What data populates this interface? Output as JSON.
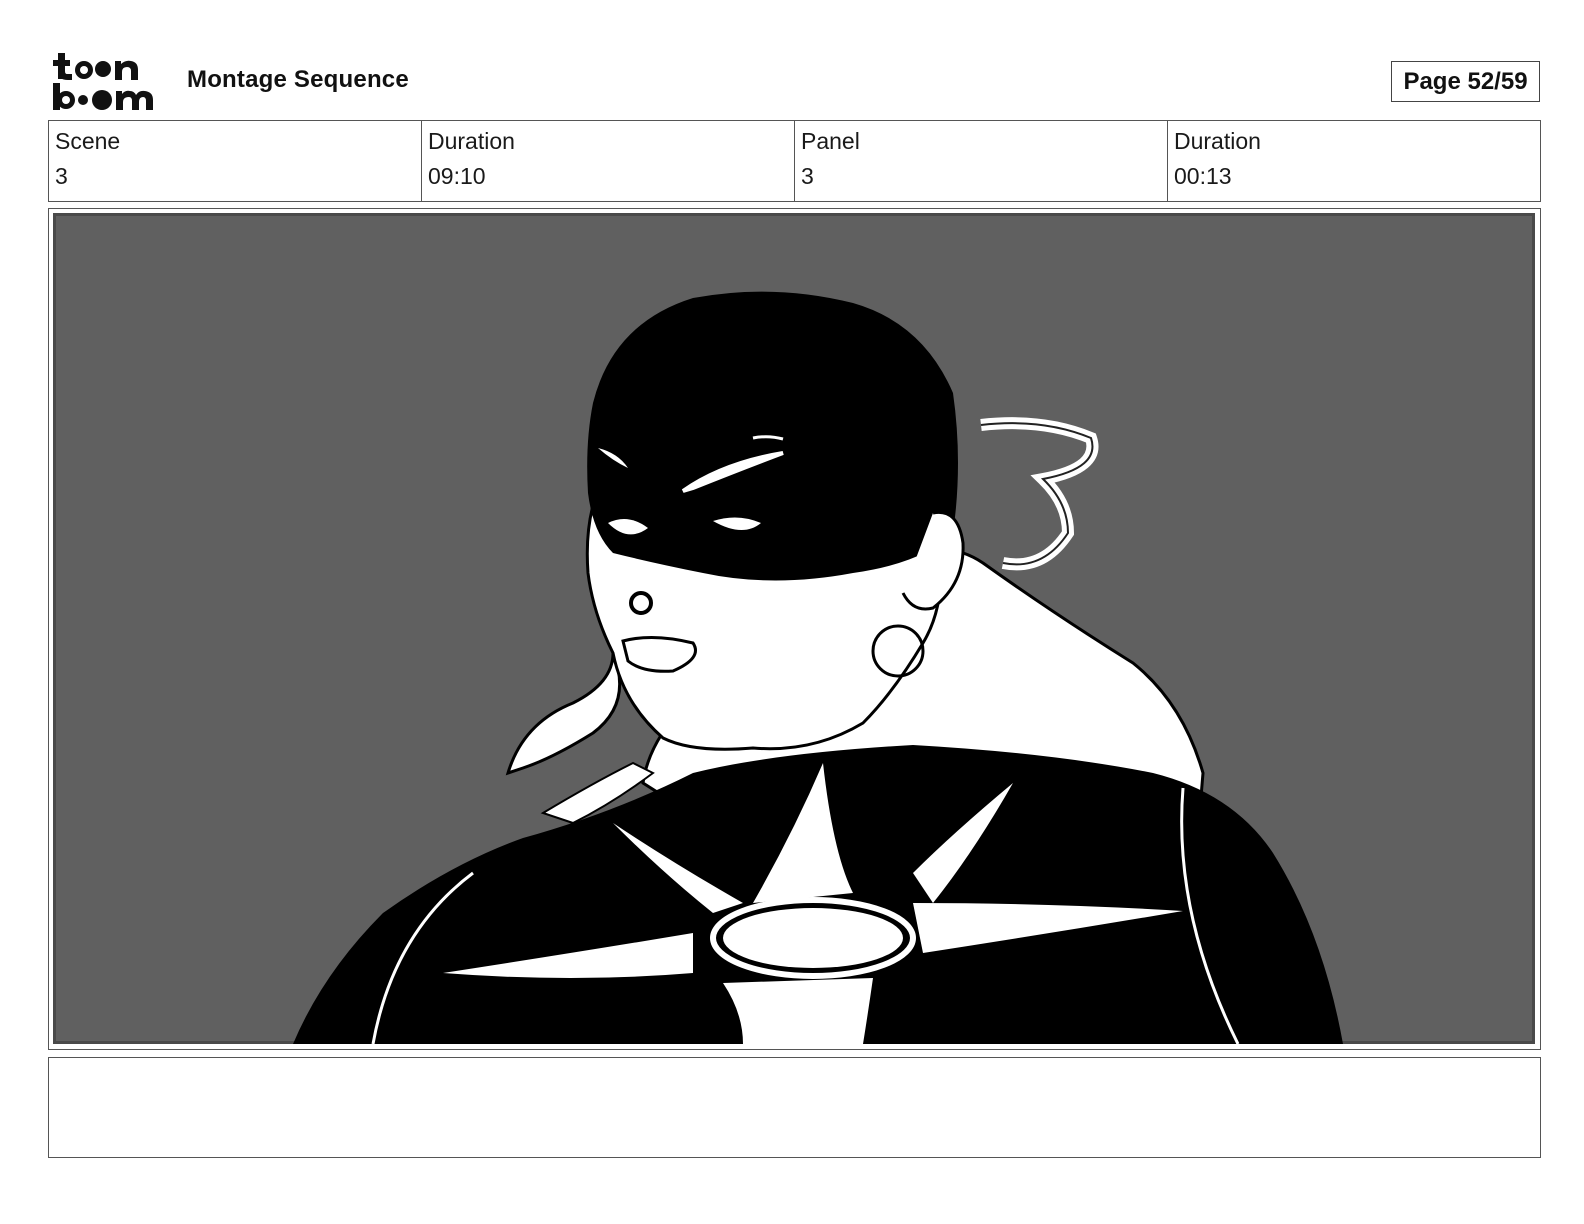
{
  "header": {
    "logo_text": "toon boom",
    "title": "Montage Sequence",
    "page_label": "Page 52/59"
  },
  "info": {
    "scene_label": "Scene",
    "scene_value": "3",
    "scene_duration_label": "Duration",
    "scene_duration_value": "09:10",
    "panel_label": "Panel",
    "panel_value": "3",
    "panel_duration_label": "Duration",
    "panel_duration_value": "00:13"
  },
  "panel": {
    "background_color": "#606060",
    "ink_color": "#000000",
    "paper_color": "#ffffff"
  },
  "notes": {
    "text": ""
  }
}
